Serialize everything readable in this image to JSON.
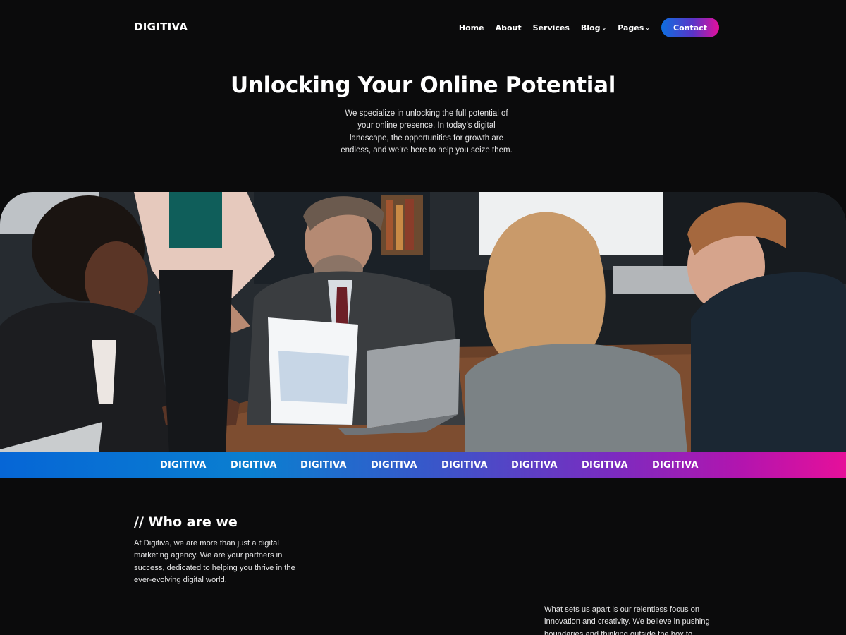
{
  "header": {
    "logo": "DIGITIVA",
    "nav": [
      {
        "label": "Home",
        "dropdown": false
      },
      {
        "label": "About",
        "dropdown": false
      },
      {
        "label": "Services",
        "dropdown": false
      },
      {
        "label": "Blog",
        "dropdown": true
      },
      {
        "label": "Pages",
        "dropdown": true
      }
    ],
    "contact_label": "Contact",
    "dropdown_glyph": "⌄"
  },
  "hero": {
    "title": "Unlocking Your Online Potential",
    "subtitle": "We specialize in unlocking the full potential of your online presence. In today’s digital landscape, the opportunities for growth are endless, and we’re here to help you seize them."
  },
  "image": {
    "icon": "team-meeting-photo"
  },
  "marquee": {
    "items": [
      "DIGITIVA",
      "DIGITIVA",
      "DIGITIVA",
      "DIGITIVA",
      "DIGITIVA",
      "DIGITIVA",
      "DIGITIVA",
      "DIGITIVA"
    ]
  },
  "who": {
    "title": "// Who are we",
    "text": "At Digitiva, we are more than just a digital marketing agency. We are your partners in success, dedicated to helping you thrive in the ever-evolving digital world."
  },
  "apart": {
    "text": "What sets us apart is our relentless focus on innovation and creativity. We believe in pushing boundaries and thinking outside the box to"
  },
  "colors": {
    "background": "#0b0b0c",
    "gradient_start": "#0666d6",
    "gradient_end": "#e6109a"
  }
}
